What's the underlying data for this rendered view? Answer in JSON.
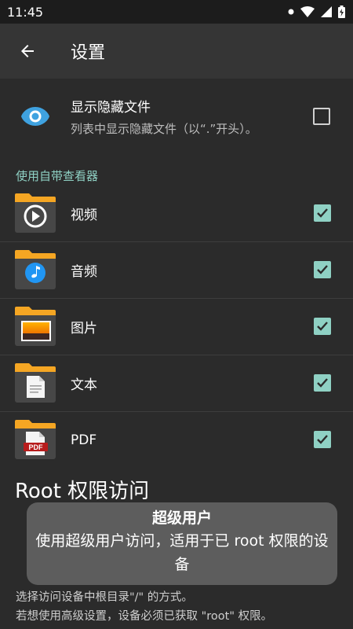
{
  "status_bar": {
    "time": "11:45"
  },
  "app_bar": {
    "title": "设置"
  },
  "show_hidden": {
    "title": "显示隐藏文件",
    "subtitle": "列表中显示隐藏文件（以“.”开头）。",
    "checked": false
  },
  "builtin_viewer": {
    "section_label": "使用自带查看器",
    "items": [
      {
        "label": "视频",
        "icon": "video-play-icon",
        "checked": true
      },
      {
        "label": "音频",
        "icon": "music-note-icon",
        "checked": true
      },
      {
        "label": "图片",
        "icon": "image-icon",
        "checked": true
      },
      {
        "label": "文本",
        "icon": "document-icon",
        "checked": true
      },
      {
        "label": "PDF",
        "icon": "pdf-icon",
        "pdf_badge": "PDF",
        "checked": true
      }
    ]
  },
  "root": {
    "title": "Root 权限访问"
  },
  "toast": {
    "title": "超级用户",
    "body": "使用超级用户访问，适用于已 root 权限的设备"
  },
  "footer": {
    "line1": "选择访问设备中根目录\"/\" 的方式。",
    "line2": "若想使用高级设置，设备必须已获取 \"root\" 权限。"
  },
  "colors": {
    "accent": "#8fd1c4",
    "eye": "#3fa2e0",
    "folder": "#f5a623"
  }
}
